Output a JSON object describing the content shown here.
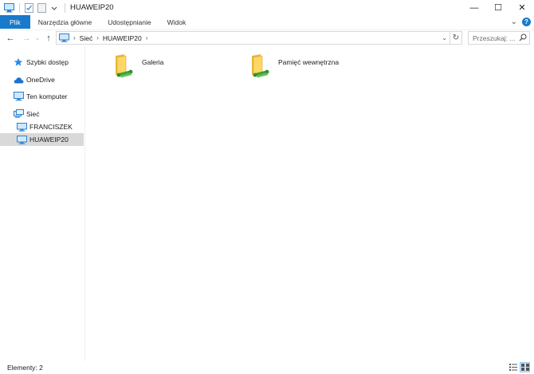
{
  "window": {
    "title": "HUAWEIP20",
    "controls": {
      "minimize": "—",
      "maximize": "☐",
      "close": "✕"
    }
  },
  "ribbon": {
    "tabs": [
      {
        "label": "Plik",
        "active": true
      },
      {
        "label": "Narzędzia główne"
      },
      {
        "label": "Udostępnianie"
      },
      {
        "label": "Widok"
      }
    ],
    "expand_glyph": "⌄",
    "help_glyph": "?"
  },
  "address": {
    "breadcrumbs": [
      "Sieć",
      "HUAWEIP20"
    ],
    "separator": "›",
    "dropdown_glyph": "⌄",
    "refresh_glyph": "↻"
  },
  "nav": {
    "back": "←",
    "forward": "→",
    "recent": "⌄",
    "up": "↑"
  },
  "search": {
    "placeholder": "Przeszukaj: ..."
  },
  "sidebar": {
    "items": [
      {
        "label": "Szybki dostęp",
        "icon": "star-icon"
      },
      {
        "label": "OneDrive",
        "icon": "cloud-icon"
      },
      {
        "label": "Ten komputer",
        "icon": "computer-icon"
      },
      {
        "label": "Sieć",
        "icon": "network-icon"
      },
      {
        "label": "FRANCISZEK",
        "icon": "monitor-icon"
      },
      {
        "label": "HUAWEIP20",
        "icon": "monitor-icon",
        "selected": true
      }
    ]
  },
  "content": {
    "items": [
      {
        "label": "Galeria",
        "icon": "shared-folder-icon"
      },
      {
        "label": "Pamięć wewnętrzna",
        "icon": "shared-folder-icon"
      }
    ]
  },
  "status": {
    "text": "Elementy: 2"
  },
  "colors": {
    "accent": "#1979ca",
    "selection": "#d9d9d9"
  }
}
